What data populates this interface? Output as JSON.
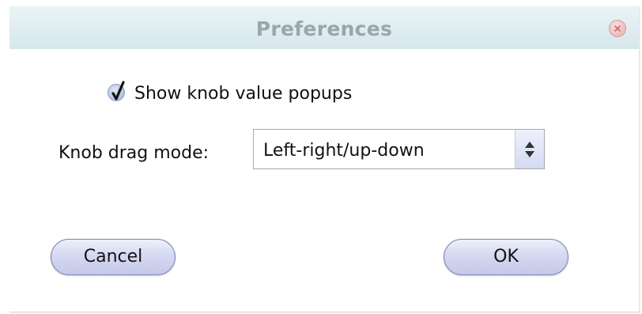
{
  "dialog": {
    "title": "Preferences",
    "close_icon": "close-x-icon"
  },
  "options": {
    "show_popups_label": "Show knob value popups",
    "show_popups_checked": true,
    "drag_mode_label": "Knob drag mode:",
    "drag_mode_value": "Left-right/up-down",
    "drag_mode_arrow_icon": "updown-arrows-icon"
  },
  "buttons": {
    "cancel_label": "Cancel",
    "ok_label": "OK"
  },
  "colors": {
    "titlebar": "#d6e7eb",
    "title_text": "#9aa6a8",
    "button_fill": "#d5d9f1",
    "close_button": "#f0b9b9"
  }
}
